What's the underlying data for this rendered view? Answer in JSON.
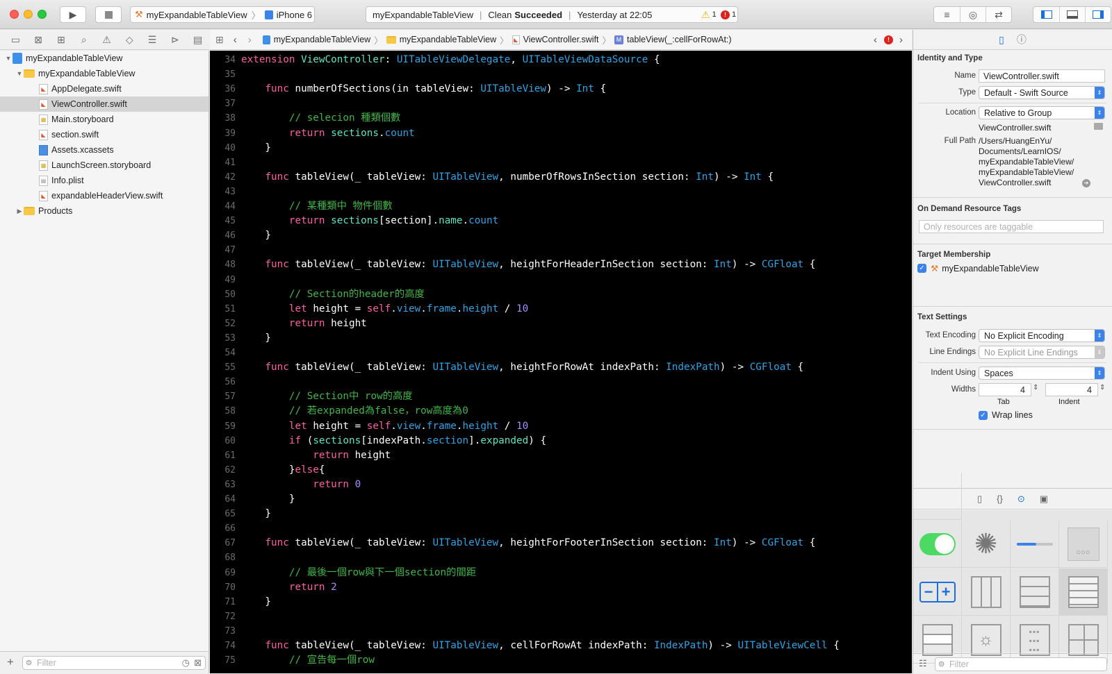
{
  "toolbar": {
    "scheme_project": "myExpandableTableView",
    "scheme_device": "iPhone 6",
    "activity_project": "myExpandableTableView",
    "activity_status_prefix": "Clean",
    "activity_status": "Succeeded",
    "activity_time": "Yesterday at 22:05",
    "warning_count": "1",
    "error_count": "1"
  },
  "navigator": {
    "items": [
      {
        "label": "myExpandableTableView",
        "kind": "project",
        "level": 0,
        "disclosure": "▼"
      },
      {
        "label": "myExpandableTableView",
        "kind": "folder",
        "level": 1,
        "disclosure": "▼"
      },
      {
        "label": "AppDelegate.swift",
        "kind": "swift",
        "level": 2
      },
      {
        "label": "ViewController.swift",
        "kind": "swift",
        "level": 2,
        "selected": true
      },
      {
        "label": "Main.storyboard",
        "kind": "storyboard",
        "level": 2
      },
      {
        "label": "section.swift",
        "kind": "swift",
        "level": 2
      },
      {
        "label": "Assets.xcassets",
        "kind": "assets",
        "level": 2
      },
      {
        "label": "LaunchScreen.storyboard",
        "kind": "storyboard",
        "level": 2
      },
      {
        "label": "Info.plist",
        "kind": "plist",
        "level": 2
      },
      {
        "label": "expandableHeaderView.swift",
        "kind": "swift",
        "level": 2
      },
      {
        "label": "Products",
        "kind": "folder",
        "level": 1,
        "disclosure": "▶"
      }
    ],
    "filter_placeholder": "Filter"
  },
  "jumpbar": {
    "crumbs": [
      "myExpandableTableView",
      "myExpandableTableView",
      "ViewController.swift",
      "tableView(_:cellForRowAt:)"
    ]
  },
  "editor": {
    "lines": [
      {
        "n": "34",
        "t": [
          [
            "kw",
            "extension "
          ],
          [
            "lt",
            "ViewController"
          ],
          [
            "pl",
            ": "
          ],
          [
            "ty",
            "UITableViewDelegate"
          ],
          [
            "pl",
            ", "
          ],
          [
            "ty",
            "UITableViewDataSource"
          ],
          [
            "pl",
            " {"
          ]
        ]
      },
      {
        "n": "35",
        "t": []
      },
      {
        "n": "36",
        "t": [
          [
            "pl",
            "    "
          ],
          [
            "kw",
            "func "
          ],
          [
            "pl",
            "numberOfSections(in tableView: "
          ],
          [
            "ty",
            "UITableView"
          ],
          [
            "pl",
            ") -> "
          ],
          [
            "ty",
            "Int"
          ],
          [
            "pl",
            " {"
          ]
        ]
      },
      {
        "n": "37",
        "t": []
      },
      {
        "n": "38",
        "t": [
          [
            "pl",
            "        "
          ],
          [
            "cm",
            "// selecion 種類個數"
          ]
        ]
      },
      {
        "n": "39",
        "t": [
          [
            "pl",
            "        "
          ],
          [
            "kw",
            "return "
          ],
          [
            "lt",
            "sections"
          ],
          [
            "pl",
            "."
          ],
          [
            "ty",
            "count"
          ]
        ]
      },
      {
        "n": "40",
        "t": [
          [
            "pl",
            "    }"
          ]
        ]
      },
      {
        "n": "41",
        "t": []
      },
      {
        "n": "42",
        "t": [
          [
            "pl",
            "    "
          ],
          [
            "kw",
            "func "
          ],
          [
            "pl",
            "tableView(_ tableView: "
          ],
          [
            "ty",
            "UITableView"
          ],
          [
            "pl",
            ", numberOfRowsInSection section: "
          ],
          [
            "ty",
            "Int"
          ],
          [
            "pl",
            ") -> "
          ],
          [
            "ty",
            "Int"
          ],
          [
            "pl",
            " {"
          ]
        ]
      },
      {
        "n": "43",
        "t": []
      },
      {
        "n": "44",
        "t": [
          [
            "pl",
            "        "
          ],
          [
            "cm",
            "// 某種類中 物件個數"
          ]
        ]
      },
      {
        "n": "45",
        "t": [
          [
            "pl",
            "        "
          ],
          [
            "kw",
            "return "
          ],
          [
            "lt",
            "sections"
          ],
          [
            "pl",
            "[section]."
          ],
          [
            "lt",
            "name"
          ],
          [
            "pl",
            "."
          ],
          [
            "ty",
            "count"
          ]
        ]
      },
      {
        "n": "46",
        "t": [
          [
            "pl",
            "    }"
          ]
        ]
      },
      {
        "n": "47",
        "t": []
      },
      {
        "n": "48",
        "t": [
          [
            "pl",
            "    "
          ],
          [
            "kw",
            "func "
          ],
          [
            "pl",
            "tableView(_ tableView: "
          ],
          [
            "ty",
            "UITableView"
          ],
          [
            "pl",
            ", heightForHeaderInSection section: "
          ],
          [
            "ty",
            "Int"
          ],
          [
            "pl",
            ") -> "
          ],
          [
            "ty",
            "CGFloat"
          ],
          [
            "pl",
            " {"
          ]
        ]
      },
      {
        "n": "49",
        "t": []
      },
      {
        "n": "50",
        "t": [
          [
            "pl",
            "        "
          ],
          [
            "cm",
            "// Section的header的高度"
          ]
        ]
      },
      {
        "n": "51",
        "t": [
          [
            "pl",
            "        "
          ],
          [
            "kw",
            "let "
          ],
          [
            "pl",
            "height = "
          ],
          [
            "kw",
            "self"
          ],
          [
            "pl",
            "."
          ],
          [
            "ty",
            "view"
          ],
          [
            "pl",
            "."
          ],
          [
            "ty",
            "frame"
          ],
          [
            "pl",
            "."
          ],
          [
            "ty",
            "height"
          ],
          [
            "pl",
            " / "
          ],
          [
            "nm",
            "10"
          ]
        ]
      },
      {
        "n": "52",
        "t": [
          [
            "pl",
            "        "
          ],
          [
            "kw",
            "return "
          ],
          [
            "pl",
            "height"
          ]
        ]
      },
      {
        "n": "53",
        "t": [
          [
            "pl",
            "    }"
          ]
        ]
      },
      {
        "n": "54",
        "t": []
      },
      {
        "n": "55",
        "t": [
          [
            "pl",
            "    "
          ],
          [
            "kw",
            "func "
          ],
          [
            "pl",
            "tableView(_ tableView: "
          ],
          [
            "ty",
            "UITableView"
          ],
          [
            "pl",
            ", heightForRowAt indexPath: "
          ],
          [
            "ty",
            "IndexPath"
          ],
          [
            "pl",
            ") -> "
          ],
          [
            "ty",
            "CGFloat"
          ],
          [
            "pl",
            " {"
          ]
        ]
      },
      {
        "n": "56",
        "t": []
      },
      {
        "n": "57",
        "t": [
          [
            "pl",
            "        "
          ],
          [
            "cm",
            "// Section中 row的高度"
          ]
        ]
      },
      {
        "n": "58",
        "t": [
          [
            "pl",
            "        "
          ],
          [
            "cm",
            "// 若expanded為false，row高度為0"
          ]
        ]
      },
      {
        "n": "59",
        "t": [
          [
            "pl",
            "        "
          ],
          [
            "kw",
            "let "
          ],
          [
            "pl",
            "height = "
          ],
          [
            "kw",
            "self"
          ],
          [
            "pl",
            "."
          ],
          [
            "ty",
            "view"
          ],
          [
            "pl",
            "."
          ],
          [
            "ty",
            "frame"
          ],
          [
            "pl",
            "."
          ],
          [
            "ty",
            "height"
          ],
          [
            "pl",
            " / "
          ],
          [
            "nm",
            "10"
          ]
        ]
      },
      {
        "n": "60",
        "t": [
          [
            "pl",
            "        "
          ],
          [
            "kw",
            "if "
          ],
          [
            "pl",
            "("
          ],
          [
            "lt",
            "sections"
          ],
          [
            "pl",
            "[indexPath."
          ],
          [
            "ty",
            "section"
          ],
          [
            "pl",
            "]."
          ],
          [
            "lt",
            "expanded"
          ],
          [
            "pl",
            ") {"
          ]
        ]
      },
      {
        "n": "61",
        "t": [
          [
            "pl",
            "            "
          ],
          [
            "kw",
            "return "
          ],
          [
            "pl",
            "height"
          ]
        ]
      },
      {
        "n": "62",
        "t": [
          [
            "pl",
            "        }"
          ],
          [
            "kw",
            "else"
          ],
          [
            "pl",
            "{"
          ]
        ]
      },
      {
        "n": "63",
        "t": [
          [
            "pl",
            "            "
          ],
          [
            "kw",
            "return "
          ],
          [
            "nm",
            "0"
          ]
        ]
      },
      {
        "n": "64",
        "t": [
          [
            "pl",
            "        }"
          ]
        ]
      },
      {
        "n": "65",
        "t": [
          [
            "pl",
            "    }"
          ]
        ]
      },
      {
        "n": "66",
        "t": []
      },
      {
        "n": "67",
        "t": [
          [
            "pl",
            "    "
          ],
          [
            "kw",
            "func "
          ],
          [
            "pl",
            "tableView(_ tableView: "
          ],
          [
            "ty",
            "UITableView"
          ],
          [
            "pl",
            ", heightForFooterInSection section: "
          ],
          [
            "ty",
            "Int"
          ],
          [
            "pl",
            ") -> "
          ],
          [
            "ty",
            "CGFloat"
          ],
          [
            "pl",
            " {"
          ]
        ]
      },
      {
        "n": "68",
        "t": []
      },
      {
        "n": "69",
        "t": [
          [
            "pl",
            "        "
          ],
          [
            "cm",
            "// 最後一個row與下一個section的間距"
          ]
        ]
      },
      {
        "n": "70",
        "t": [
          [
            "pl",
            "        "
          ],
          [
            "kw",
            "return "
          ],
          [
            "nm",
            "2"
          ]
        ]
      },
      {
        "n": "71",
        "t": [
          [
            "pl",
            "    }"
          ]
        ]
      },
      {
        "n": "72",
        "t": []
      },
      {
        "n": "73",
        "t": []
      },
      {
        "n": "74",
        "t": [
          [
            "pl",
            "    "
          ],
          [
            "kw",
            "func "
          ],
          [
            "pl",
            "tableView(_ tableView: "
          ],
          [
            "ty",
            "UITableView"
          ],
          [
            "pl",
            ", cellForRowAt indexPath: "
          ],
          [
            "ty",
            "IndexPath"
          ],
          [
            "pl",
            ") -> "
          ],
          [
            "ty",
            "UITableViewCell"
          ],
          [
            "pl",
            " {"
          ]
        ]
      },
      {
        "n": "75",
        "t": [
          [
            "pl",
            "        "
          ],
          [
            "cm",
            "// 宣告每一個row"
          ]
        ]
      }
    ]
  },
  "inspector": {
    "identity": {
      "heading": "Identity and Type",
      "name_label": "Name",
      "name_value": "ViewController.swift",
      "type_label": "Type",
      "type_value": "Default - Swift Source",
      "location_label": "Location",
      "location_value": "Relative to Group",
      "location_file": "ViewController.swift",
      "fullpath_label": "Full Path",
      "fullpath_lines": [
        "/Users/HuangEnYu/",
        "Documents/LearnIOS/",
        "myExpandableTableView/",
        "myExpandableTableView/",
        "ViewController.swift"
      ]
    },
    "odr": {
      "heading": "On Demand Resource Tags",
      "placeholder": "Only resources are taggable"
    },
    "target": {
      "heading": "Target Membership",
      "target_name": "myExpandableTableView"
    },
    "text": {
      "heading": "Text Settings",
      "encoding_label": "Text Encoding",
      "encoding_value": "No Explicit Encoding",
      "endings_label": "Line Endings",
      "endings_value": "No Explicit Line Endings",
      "indent_label": "Indent Using",
      "indent_value": "Spaces",
      "widths_label": "Widths",
      "tab_value": "4",
      "indent_width_value": "4",
      "tab_caption": "Tab",
      "indent_caption": "Indent",
      "wrap_label": "Wrap lines"
    },
    "library": {
      "filter_placeholder": "Filter"
    }
  },
  "colors": {
    "accent": "#1a6fe0",
    "editor_bg": "#000000",
    "keyword": "#fc5fa3",
    "type": "#2fa3e6",
    "comment": "#41b645",
    "number": "#a68cff",
    "project_symbol": "#5fe3c4"
  }
}
